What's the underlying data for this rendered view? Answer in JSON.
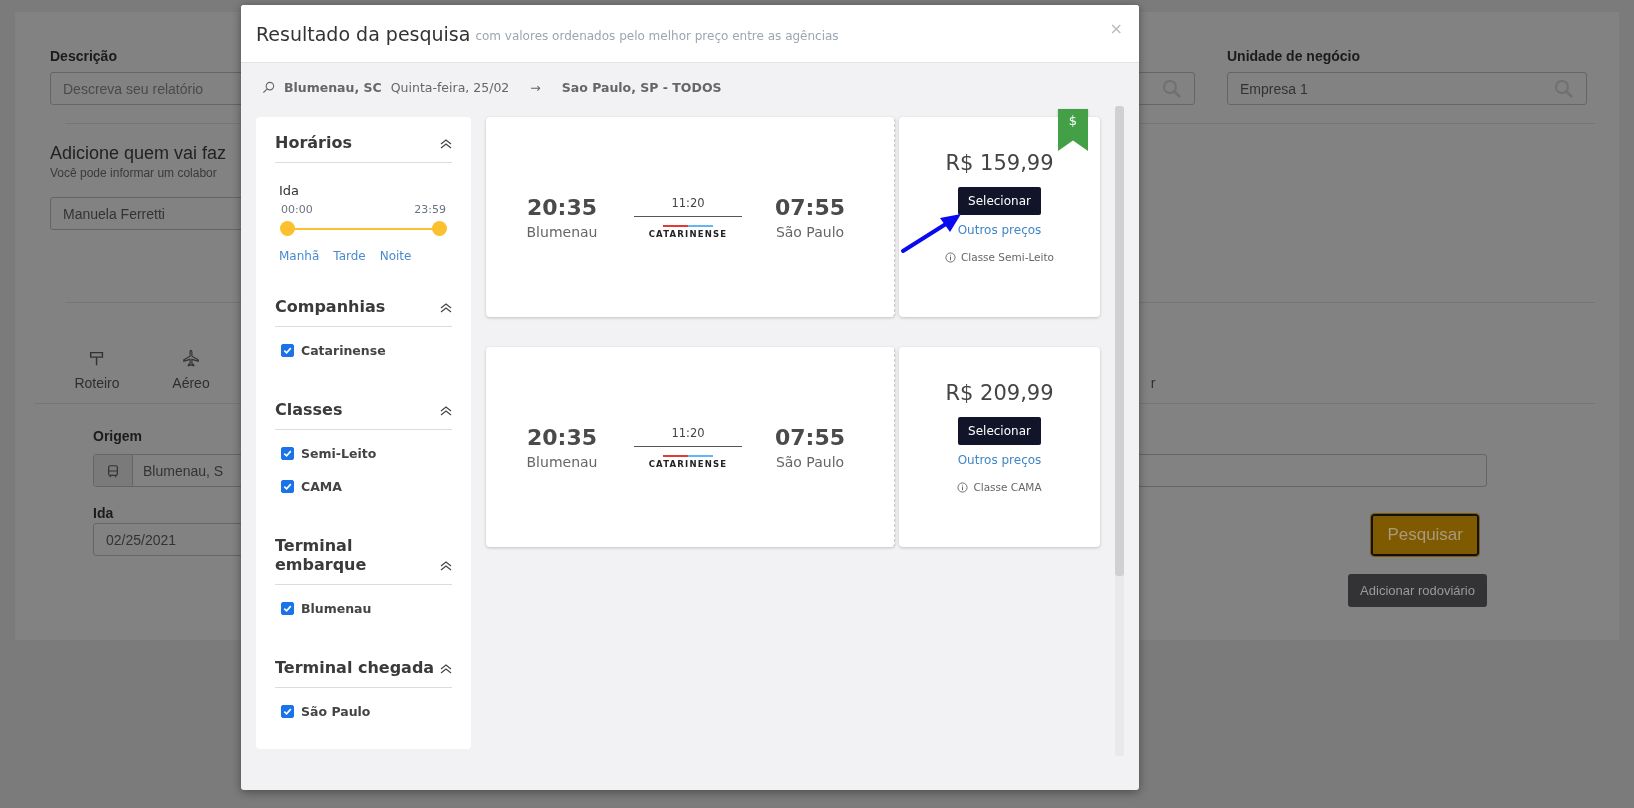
{
  "background": {
    "fields": [
      {
        "label": "Descrição",
        "placeholder": "Descreva seu relatório"
      },
      {
        "label": "Unidade de negócio",
        "value": "Empresa 1"
      }
    ],
    "collaborator": {
      "title": "Adicione quem vai faz",
      "subtitle": "Você pode informar um colabor",
      "value": "Manuela Ferretti"
    },
    "tabs": [
      {
        "label": "Roteiro"
      },
      {
        "label": "Aéreo"
      },
      {
        "label": "r"
      }
    ],
    "origin": {
      "label": "Origem",
      "value": "Blumenau, S"
    },
    "departure": {
      "label": "Ida",
      "value": "02/25/2021"
    },
    "buttons": [
      "Pesquisar",
      "Adicionar rodoviário"
    ]
  },
  "dialog": {
    "title": "Resultado da pesquisa",
    "subtitle": "com valores ordenados pelo melhor preço entre as agências",
    "close": "×",
    "route": {
      "origin": "Blumenau, SC",
      "date": "Quinta-feira, 25/02",
      "arrow": "→",
      "destination": "Sao Paulo, SP - TODOS"
    },
    "filters": [
      {
        "title": "Horários",
        "kind": "time",
        "direction": "Ida",
        "start": "00:00",
        "end": "23:59",
        "level": 1,
        "periods": [
          "Manhã",
          "Tarde",
          "Noite"
        ]
      },
      {
        "title": "Companhias",
        "kind": "checks",
        "options": [
          {
            "label": "Catarinense",
            "checked": true
          }
        ]
      },
      {
        "title": "Classes",
        "kind": "checks",
        "options": [
          {
            "label": "Semi-Leito",
            "checked": true
          },
          {
            "label": "CAMA",
            "checked": true
          }
        ]
      },
      {
        "title": "Terminal embarque",
        "kind": "checks",
        "options": [
          {
            "label": "Blumenau",
            "checked": true
          }
        ]
      },
      {
        "title": "Terminal chegada",
        "kind": "checks",
        "options": [
          {
            "label": "São Paulo",
            "checked": true
          }
        ]
      }
    ],
    "results": [
      {
        "departure": "20:35",
        "origin": "Blumenau",
        "duration": "11:20",
        "carrier": "CATARINENSE",
        "arrival": "07:55",
        "destination": "São Paulo",
        "price": "R$ 159,99",
        "select": "Selecionar",
        "other": "Outros preços",
        "class": "Classe Semi-Leito",
        "ribbon": "$",
        "pointer": true
      },
      {
        "departure": "20:35",
        "origin": "Blumenau",
        "duration": "11:20",
        "carrier": "CATARINENSE",
        "arrival": "07:55",
        "destination": "São Paulo",
        "price": "R$ 209,99",
        "select": "Selecionar",
        "other": "Outros preços",
        "class": "Classe CAMA",
        "pointer": false
      }
    ]
  }
}
